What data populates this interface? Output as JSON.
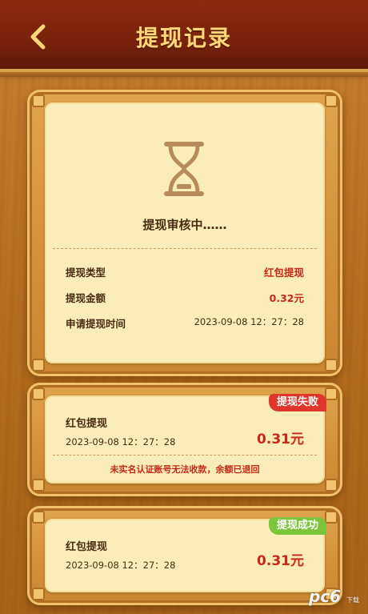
{
  "header": {
    "title": "提现记录",
    "back_icon": "chevron-left-icon"
  },
  "main_card": {
    "status_icon": "hourglass-icon",
    "status_text": "提现审核中……",
    "rows": [
      {
        "label": "提现类型",
        "value": "红包提现"
      },
      {
        "label": "提现金额",
        "value": "0.32元"
      },
      {
        "label": "申请提现时间",
        "value": "2023-09-08 12：27：28"
      }
    ]
  },
  "records": [
    {
      "title": "红包提现",
      "time": "2023-09-08 12：27：28",
      "amount": "0.31元",
      "badge": "提现失败",
      "badge_color": "#e0352a",
      "note": "未实名认证账号无法收款，余额已退回"
    },
    {
      "title": "红包提现",
      "time": "2023-09-08 12：27：28",
      "amount": "0.31元",
      "badge": "提现成功",
      "badge_color": "#7cc43a"
    }
  ],
  "watermark": {
    "brand": "pc6",
    "sub": "下载站"
  },
  "colors": {
    "accent_red": "#c7281a",
    "header_bg": "#7a220b",
    "title_gold": "#ffd778",
    "paper": "#fbedb9"
  }
}
